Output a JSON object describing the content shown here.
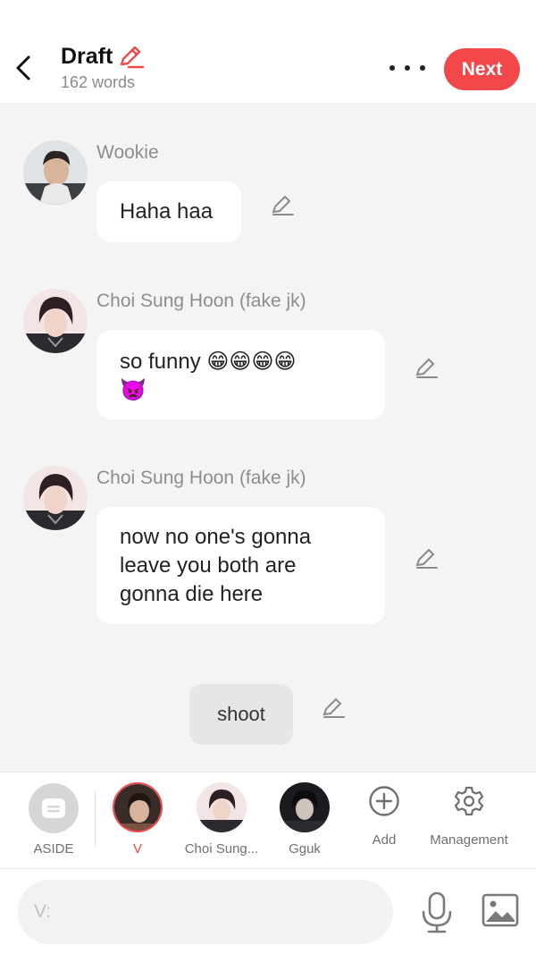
{
  "header": {
    "title": "Draft",
    "word_count": "162 words",
    "next_label": "Next",
    "accent_color": "#f2484a"
  },
  "messages": [
    {
      "sender": "Wookie",
      "text": "Haha haa"
    },
    {
      "sender": "Choi Sung Hoon (fake jk)",
      "text": "so funny",
      "emojis": "😁😁😁😁",
      "emoji_line2": "👿"
    },
    {
      "sender": "Choi Sung Hoon (fake jk)",
      "lines": [
        "now no one's gonna",
        "leave you both are",
        "gonna die here"
      ]
    }
  ],
  "narration": {
    "text": "shoot"
  },
  "characters": [
    {
      "label": "ASIDE",
      "icon": "aside-icon",
      "selected": false
    },
    {
      "label": "V",
      "selected": true
    },
    {
      "label": "Choi Sung...",
      "selected": false
    },
    {
      "label": "Gguk",
      "selected": false
    },
    {
      "label": "Add",
      "icon": "plus-circle-icon"
    },
    {
      "label": "Management",
      "icon": "gear-icon"
    }
  ],
  "input": {
    "placeholder": "V:"
  },
  "icons": [
    "back-arrow-icon",
    "pencil-icon",
    "more-icon",
    "mic-icon",
    "image-icon"
  ]
}
